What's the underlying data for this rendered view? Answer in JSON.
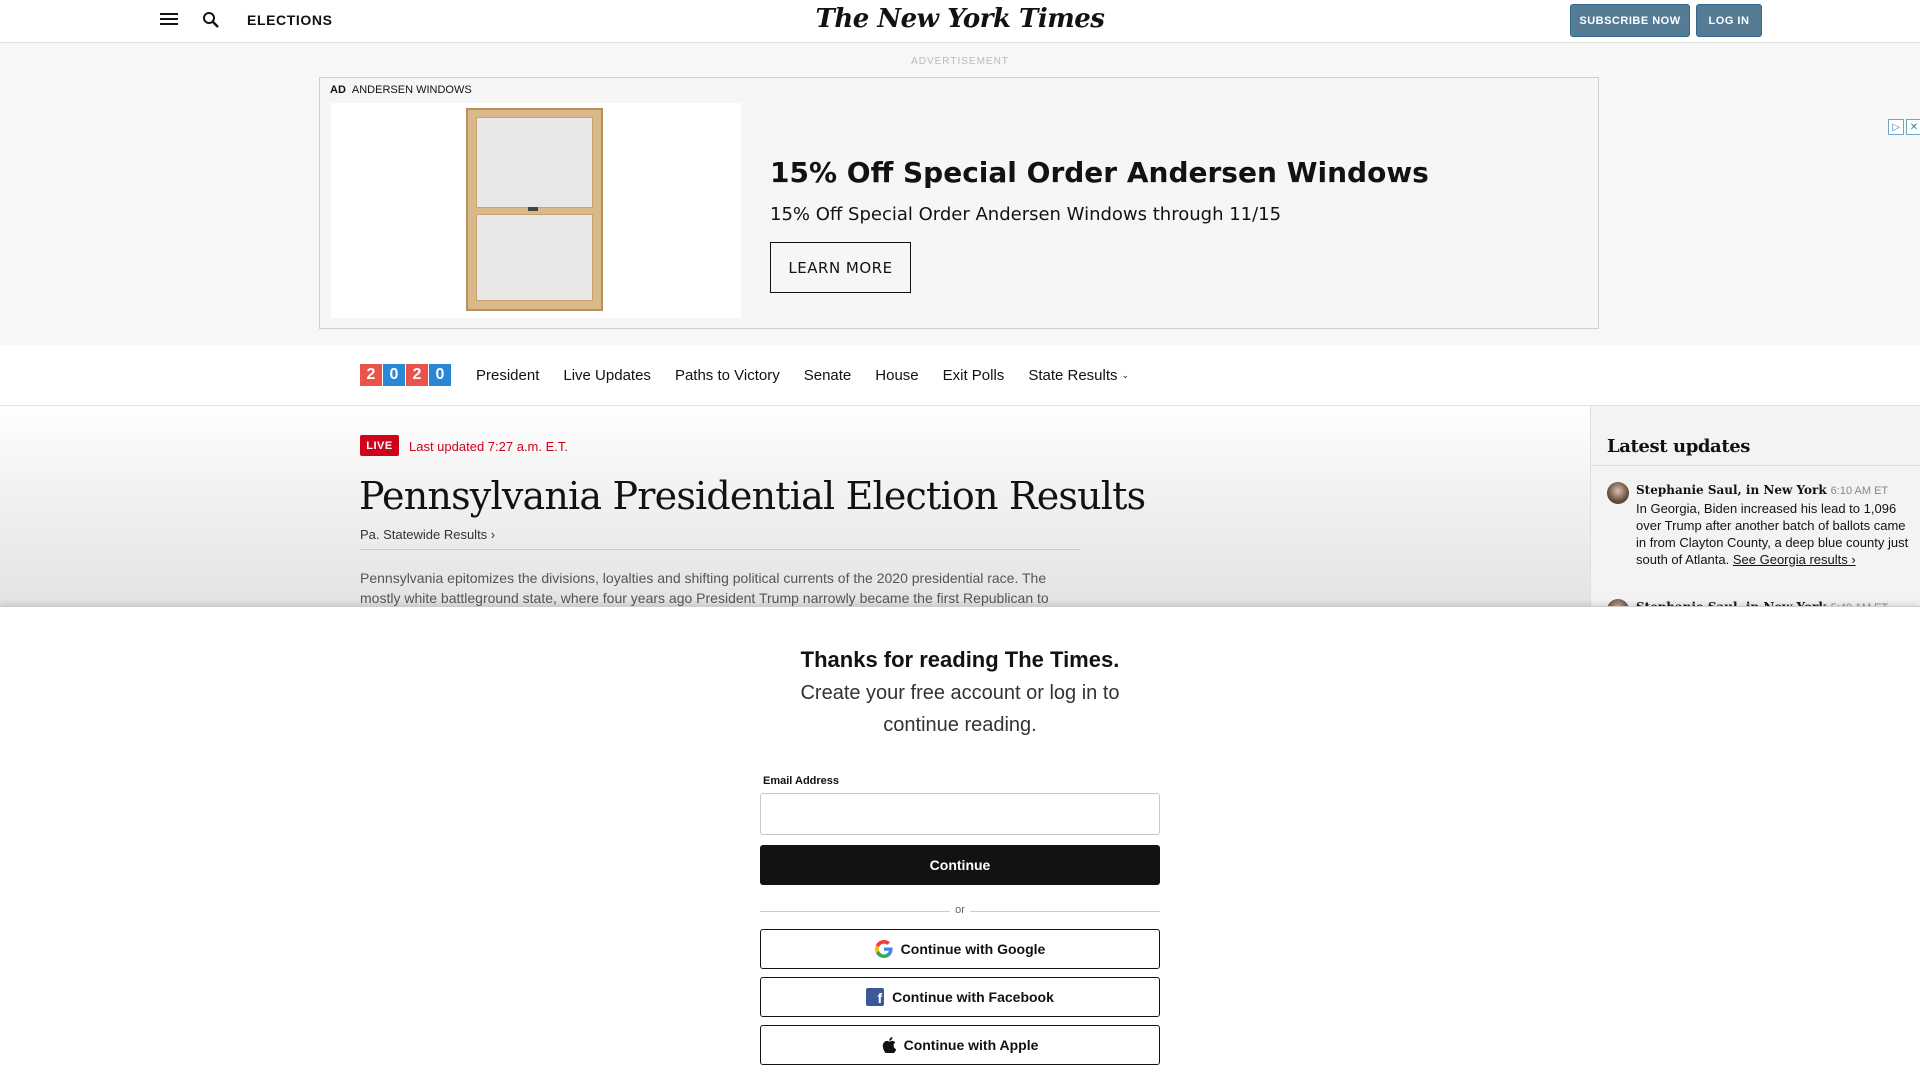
{
  "header": {
    "section": "ELECTIONS",
    "logo": "The New York Times",
    "subscribe_label": "SUBSCRIBE NOW",
    "login_label": "LOG IN",
    "subscribe_color": "#567b95"
  },
  "ad": {
    "label": "ADVERTISEMENT",
    "tag": "AD",
    "advertiser": "ANDERSEN WINDOWS",
    "headline": "15% Off Special Order Andersen Windows",
    "subhead": "15% Off Special Order Andersen Windows through 11/15",
    "cta": "LEARN MORE",
    "choices_icons": [
      "adchoices-icon",
      "close-icon"
    ]
  },
  "election_nav": {
    "year_digits": [
      "2",
      "0",
      "2",
      "0"
    ],
    "year_colors": [
      "#e8544a",
      "#2a86d6",
      "#e8544a",
      "#2a86d6"
    ],
    "links": [
      "President",
      "Live Updates",
      "Paths to Victory",
      "Senate",
      "House",
      "Exit Polls",
      "State Results"
    ]
  },
  "article": {
    "live_badge": "LIVE",
    "updated": "Last updated 7:27 a.m. E.T.",
    "headline": "Pennsylvania Presidential Election Results",
    "state_link": "Pa. Statewide Results ›",
    "body": "Pennsylvania epitomizes the divisions, loyalties and shifting political currents of the 2020 presidential race. The mostly white battleground state, where four years ago President Trump narrowly became the first Republican to",
    "live_color": "#d0021b"
  },
  "sidebar": {
    "title": "Latest updates",
    "items": [
      {
        "author": "Stephanie Saul, in New York",
        "time": "6:10 AM ET",
        "text": "In Georgia, Biden increased his lead to 1,096 over Trump after another batch of ballots came in from Clayton County, a deep blue county just south of Atlanta.",
        "link": "See Georgia results ›"
      },
      {
        "author": "Stephanie Saul, in New York",
        "time": "5:40 AM ET"
      }
    ]
  },
  "regwall": {
    "title": "Thanks for reading The Times.",
    "subtitle": "Create your free account or log in to continue reading.",
    "email_label": "Email Address",
    "email_value": "",
    "continue_label": "Continue",
    "or_label": "or",
    "google_label": "Continue with Google",
    "facebook_label": "Continue with Facebook",
    "apple_label": "Continue with Apple"
  }
}
